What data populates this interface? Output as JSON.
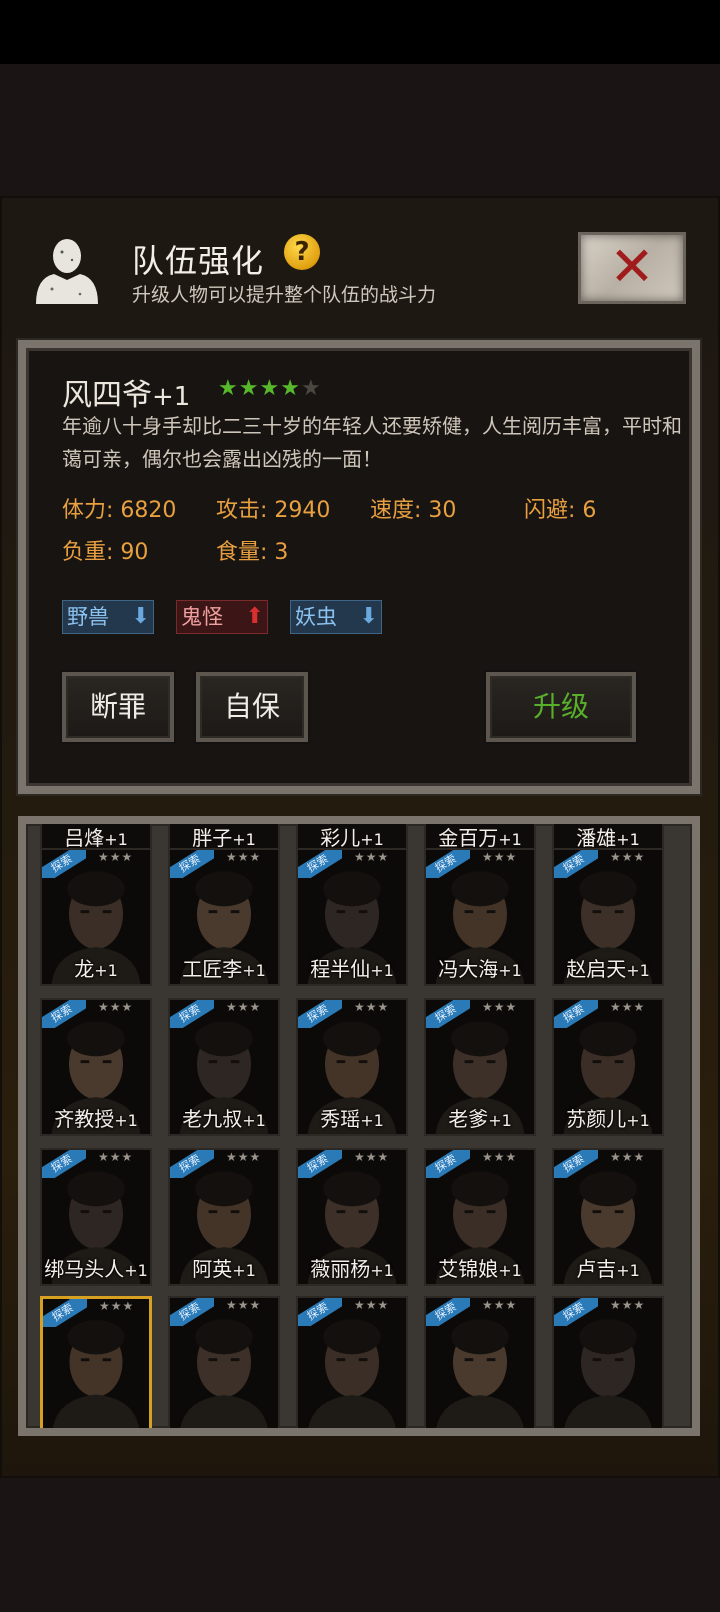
{
  "header": {
    "title": "队伍强化",
    "help_icon": "?",
    "subtitle": "升级人物可以提升整个队伍的战斗力",
    "close_icon": "✕"
  },
  "character": {
    "name": "风四爷",
    "level_suffix": "+1",
    "stars_filled": 4,
    "stars_total": 5,
    "description": "年逾八十身手却比二三十岁的年轻人还要矫健，人生阅历丰富，平时和蔼可亲，偶尔也会露出凶残的一面！",
    "stats": {
      "hp_label": "体力: 6820",
      "atk_label": "攻击: 2940",
      "spd_label": "速度: 30",
      "dodge_label": "闪避: 6",
      "load_label": "负重: 90",
      "food_label": "食量: 3"
    },
    "tags": [
      {
        "label": "野兽",
        "trend": "down"
      },
      {
        "label": "鬼怪",
        "trend": "up"
      },
      {
        "label": "妖虫",
        "trend": "down"
      }
    ]
  },
  "buttons": {
    "skill1": "断罪",
    "skill2": "自保",
    "upgrade": "升级"
  },
  "roster": {
    "top_partial": [
      {
        "name": "吕烽",
        "plus": "+1"
      },
      {
        "name": "胖子",
        "plus": "+1"
      },
      {
        "name": "彩儿",
        "plus": "+1"
      },
      {
        "name": "金百万",
        "plus": "+1"
      },
      {
        "name": "潘雄",
        "plus": "+1"
      }
    ],
    "badge_label": "探索",
    "rows": [
      [
        {
          "name": "龙",
          "plus": "+1"
        },
        {
          "name": "工匠李",
          "plus": "+1"
        },
        {
          "name": "程半仙",
          "plus": "+1"
        },
        {
          "name": "冯大海",
          "plus": "+1"
        },
        {
          "name": "赵启天",
          "plus": "+1"
        }
      ],
      [
        {
          "name": "齐教授",
          "plus": "+1"
        },
        {
          "name": "老九叔",
          "plus": "+1"
        },
        {
          "name": "秀瑶",
          "plus": "+1"
        },
        {
          "name": "老爹",
          "plus": "+1"
        },
        {
          "name": "苏颜儿",
          "plus": "+1"
        }
      ],
      [
        {
          "name": "绑马头人",
          "plus": "+1"
        },
        {
          "name": "阿英",
          "plus": "+1"
        },
        {
          "name": "薇丽杨",
          "plus": "+1"
        },
        {
          "name": "艾锦娘",
          "plus": "+1"
        },
        {
          "name": "卢吉",
          "plus": "+1"
        }
      ],
      [
        {
          "name": "",
          "plus": "",
          "selected": true
        },
        {
          "name": "",
          "plus": ""
        },
        {
          "name": "",
          "plus": ""
        },
        {
          "name": "",
          "plus": ""
        },
        {
          "name": "",
          "plus": ""
        }
      ]
    ]
  },
  "colors": {
    "accent_orange": "#e8a040",
    "upgrade_green": "#58b02a",
    "star_green": "#58b82c",
    "selected_gold": "#d8a020"
  }
}
